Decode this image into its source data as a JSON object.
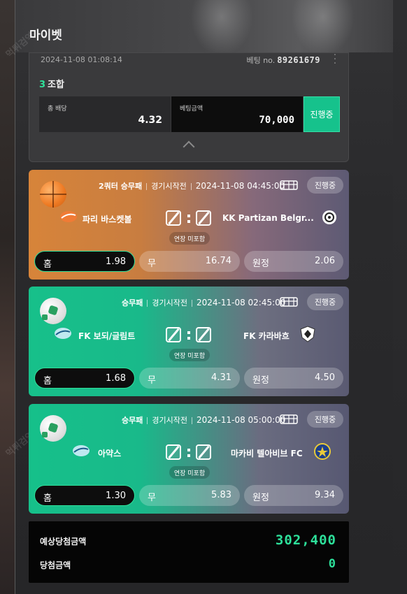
{
  "header": {
    "title": "마이벳",
    "watermark": "먹튀검역"
  },
  "bet": {
    "datetime": "2024-11-08 01:08:14",
    "bet_no_label": "베팅 no.",
    "bet_no": "89261679",
    "combo_count": "3",
    "combo_label": "조합",
    "total_odds_label": "총 배당",
    "total_odds": "4.32",
    "amount_label": "베팅금액",
    "amount": "70,000",
    "status": "진행중"
  },
  "matches": [
    {
      "sport_icon": "basketball-icon",
      "type": "2쿼터 승무패",
      "state": "경기시작전",
      "datetime": "2024-11-08 04:45:00",
      "live": "진행중",
      "home_team": "파리 바스켓볼",
      "away_team": "KK Partizan Belgr...",
      "ot": "연장 미포함",
      "home_label": "홈",
      "home_odds": "1.98",
      "draw_label": "무",
      "draw_odds": "16.74",
      "away_label": "원정",
      "away_odds": "2.06"
    },
    {
      "sport_icon": "soccer-ball-icon",
      "type": "승무패",
      "state": "경기시작전",
      "datetime": "2024-11-08 02:45:00",
      "live": "진행중",
      "home_team": "FK 보되/글림트",
      "away_team": "FK 카라바흐",
      "ot": "연장 미포함",
      "home_label": "홈",
      "home_odds": "1.68",
      "draw_label": "무",
      "draw_odds": "4.31",
      "away_label": "원정",
      "away_odds": "4.50"
    },
    {
      "sport_icon": "soccer-ball-icon",
      "type": "승무패",
      "state": "경기시작전",
      "datetime": "2024-11-08 05:00:00",
      "live": "진행중",
      "home_team": "아약스",
      "away_team": "마카비 텔아비브 FC",
      "ot": "연장 미포함",
      "home_label": "홈",
      "home_odds": "1.30",
      "draw_label": "무",
      "draw_odds": "5.83",
      "away_label": "원정",
      "away_odds": "9.34"
    }
  ],
  "summary": {
    "expected_label": "예상당첨금액",
    "expected_value": "302,400",
    "won_label": "당첨금액",
    "won_value": "0"
  },
  "colors": {
    "accent": "#2de09a",
    "basketball_card": "#d7843a",
    "soccer_card": "#17c08a"
  }
}
